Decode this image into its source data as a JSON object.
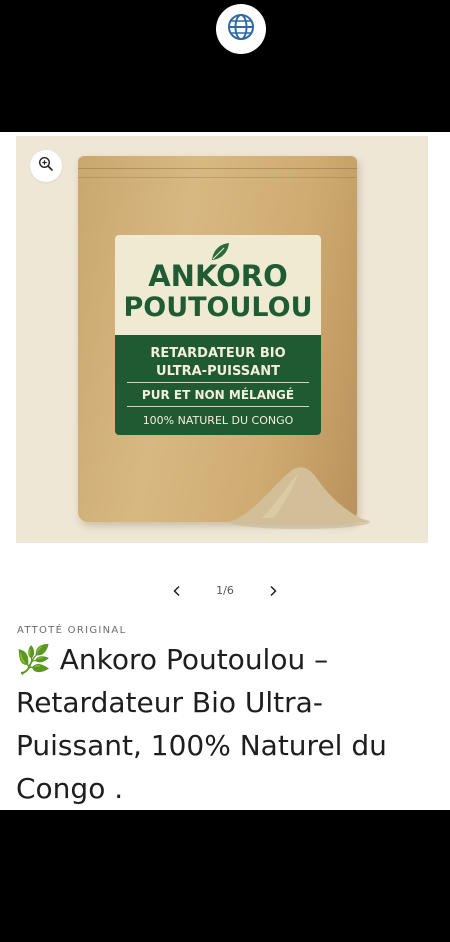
{
  "top_bar": {
    "globe_icon": "globe-icon"
  },
  "product_media": {
    "zoom_icon": "zoom-in-icon",
    "package": {
      "brand_line1": "ANKORO",
      "brand_line2": "POUTOULOU",
      "line1": "RETARDATEUR BIO",
      "line2": "ULTRA-PUISSANT",
      "line3": "PUR ET NON MÉLANGÉ",
      "line4": "100% NATUREL DU CONGO",
      "leaf_icon": "leaf-icon"
    }
  },
  "pager": {
    "counter": "1/6",
    "prev_icon": "chevron-left-icon",
    "next_icon": "chevron-right-icon"
  },
  "product": {
    "vendor": "ATTOTÉ ORIGINAL",
    "title": "🌿 Ankoro Poutoulou – Retardateur Bio Ultra-Puissant, 100% Naturel du Congo ."
  },
  "colors": {
    "brand_green": "#1f5a33",
    "kraft": "#cfab72",
    "background_beige": "#efe7d5"
  }
}
